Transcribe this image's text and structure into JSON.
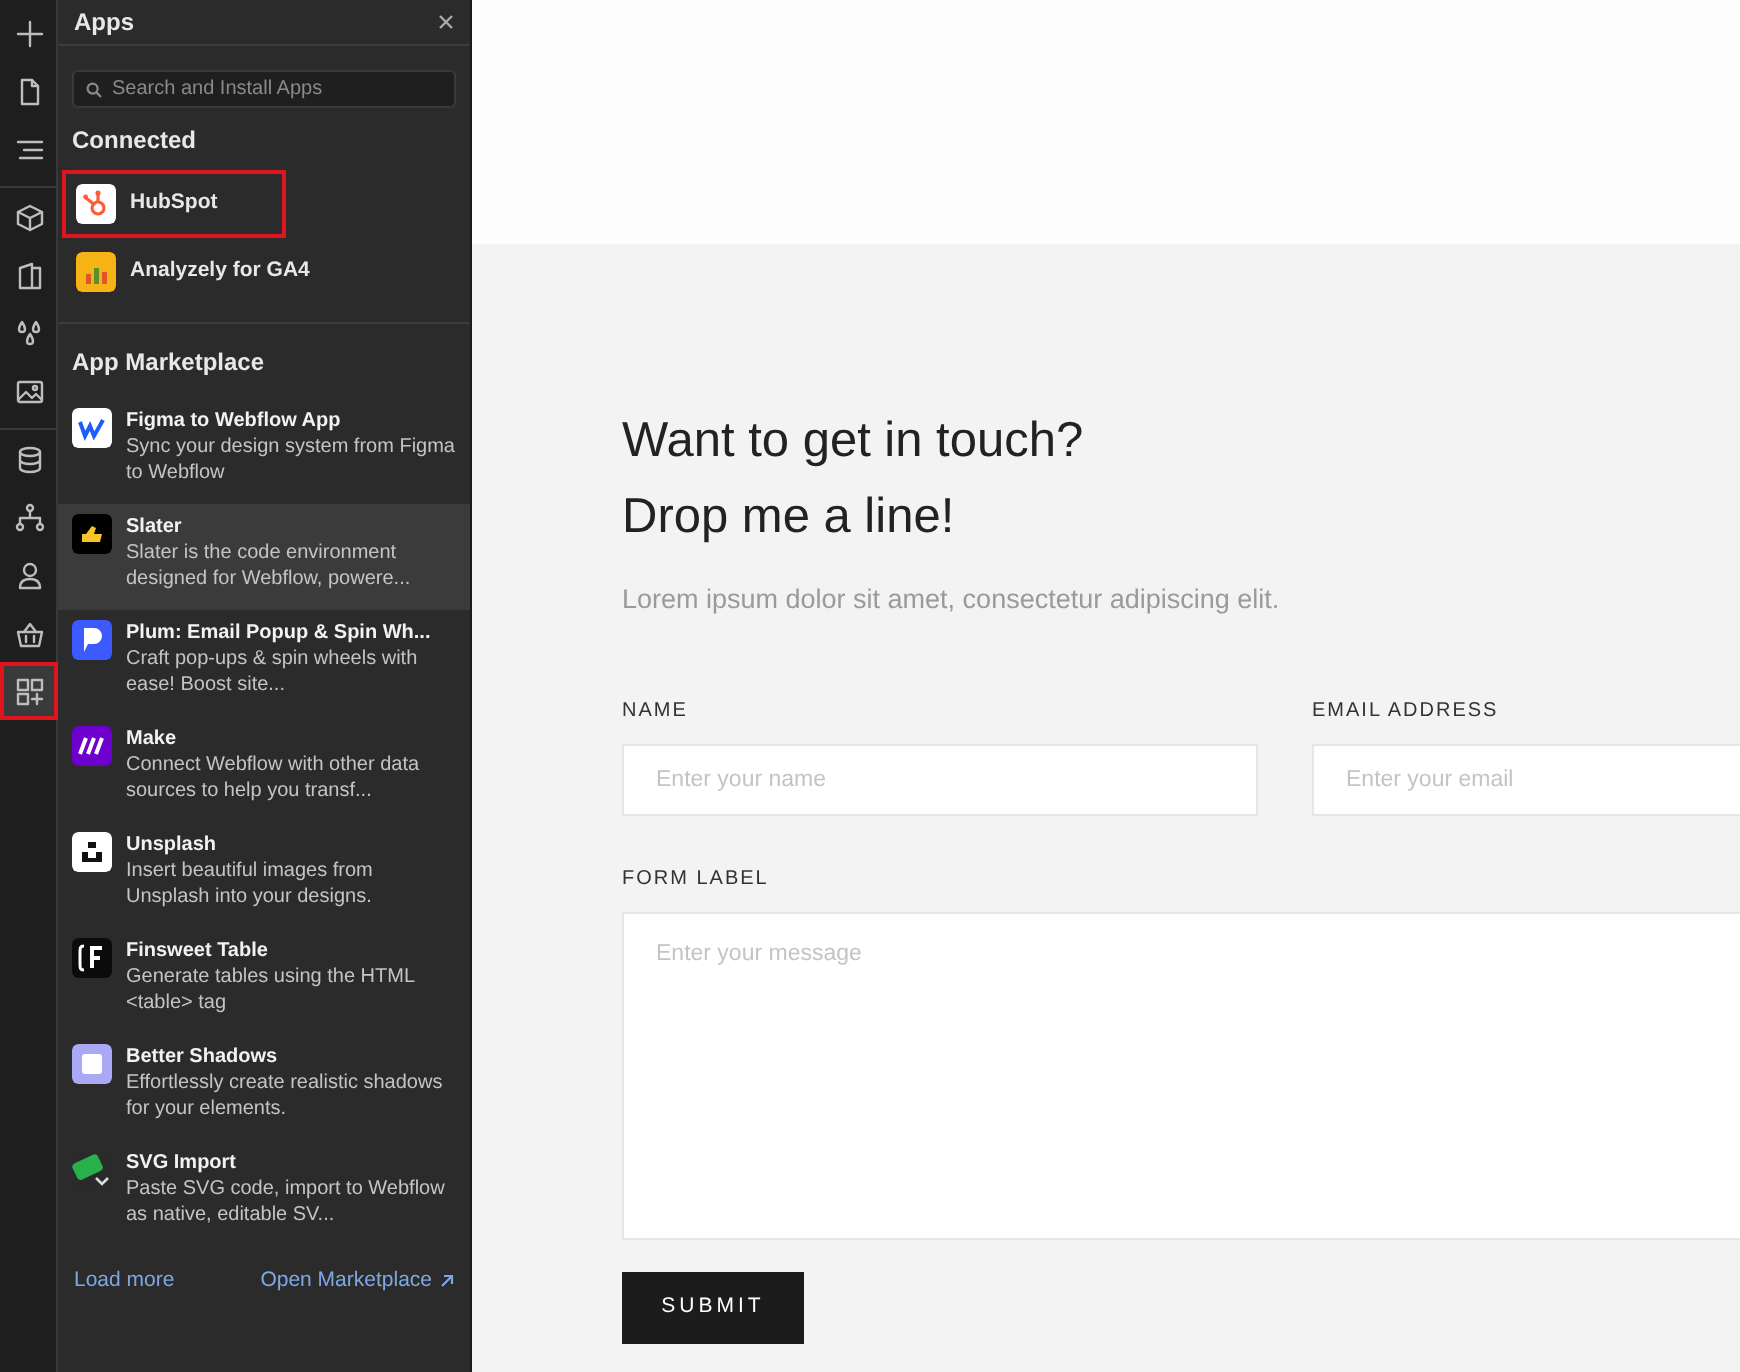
{
  "rail": {
    "groups": [
      [
        {
          "kind": "plus",
          "selected": false,
          "highlighted": false
        },
        {
          "kind": "page",
          "selected": false,
          "highlighted": false
        },
        {
          "kind": "lines",
          "selected": false,
          "highlighted": false
        }
      ],
      [
        {
          "kind": "cube",
          "selected": false,
          "highlighted": false
        },
        {
          "kind": "book",
          "selected": false,
          "highlighted": false
        },
        {
          "kind": "drops",
          "selected": false,
          "highlighted": false
        },
        {
          "kind": "image",
          "selected": false,
          "highlighted": false
        }
      ],
      [
        {
          "kind": "database",
          "selected": false,
          "highlighted": false
        },
        {
          "kind": "tree",
          "selected": false,
          "highlighted": false
        },
        {
          "kind": "person",
          "selected": false,
          "highlighted": false
        },
        {
          "kind": "basket",
          "selected": false,
          "highlighted": false
        },
        {
          "kind": "apps",
          "selected": true,
          "highlighted": true
        }
      ]
    ]
  },
  "panel": {
    "title": "Apps",
    "search": {
      "placeholder": "Search and Install Apps"
    },
    "connected": {
      "heading": "Connected",
      "items": [
        {
          "name": "HubSpot",
          "kind": "hubspot",
          "highlighted": true
        },
        {
          "name": "Analyzely for GA4",
          "kind": "analyzely",
          "highlighted": false
        }
      ]
    },
    "marketplace": {
      "heading": "App Marketplace",
      "items": [
        {
          "name": "Figma to Webflow App",
          "description": "Sync your design system from Figma to Webflow",
          "kind": "figma",
          "selected": false
        },
        {
          "name": "Slater",
          "description": "Slater is the code environment designed for Webflow, powere...",
          "kind": "slater",
          "selected": true
        },
        {
          "name": "Plum: Email Popup & Spin Wh...",
          "description": "Craft pop-ups & spin wheels with ease! Boost site...",
          "kind": "plum",
          "selected": false
        },
        {
          "name": "Make",
          "description": "Connect Webflow with other data sources to help you transf...",
          "kind": "make",
          "selected": false
        },
        {
          "name": "Unsplash",
          "description": "Insert beautiful images from Unsplash into your designs.",
          "kind": "unsplash",
          "selected": false
        },
        {
          "name": "Finsweet Table",
          "description": "Generate tables using the HTML <table> tag",
          "kind": "finsweet",
          "selected": false
        },
        {
          "name": "Better Shadows",
          "description": "Effortlessly create realistic shadows for your elements.",
          "kind": "shadows",
          "selected": false
        },
        {
          "name": "SVG Import",
          "description": "Paste SVG code, import to Webflow as native, editable SV...",
          "kind": "svg",
          "selected": false
        }
      ]
    },
    "footer": {
      "load_more": "Load more",
      "open_marketplace": "Open Marketplace"
    }
  },
  "canvas": {
    "heading_lines": [
      "Want to get in touch?",
      "Drop me a line!"
    ],
    "intro": "Lorem ipsum dolor sit amet, consectetur adipiscing elit.",
    "fields": [
      {
        "label": "NAME",
        "placeholder": "Enter your name"
      },
      {
        "label": "EMAIL ADDRESS",
        "placeholder": "Enter your email"
      }
    ],
    "message": {
      "label": "FORM LABEL",
      "placeholder": "Enter your message"
    },
    "submit": "SUBMIT"
  }
}
